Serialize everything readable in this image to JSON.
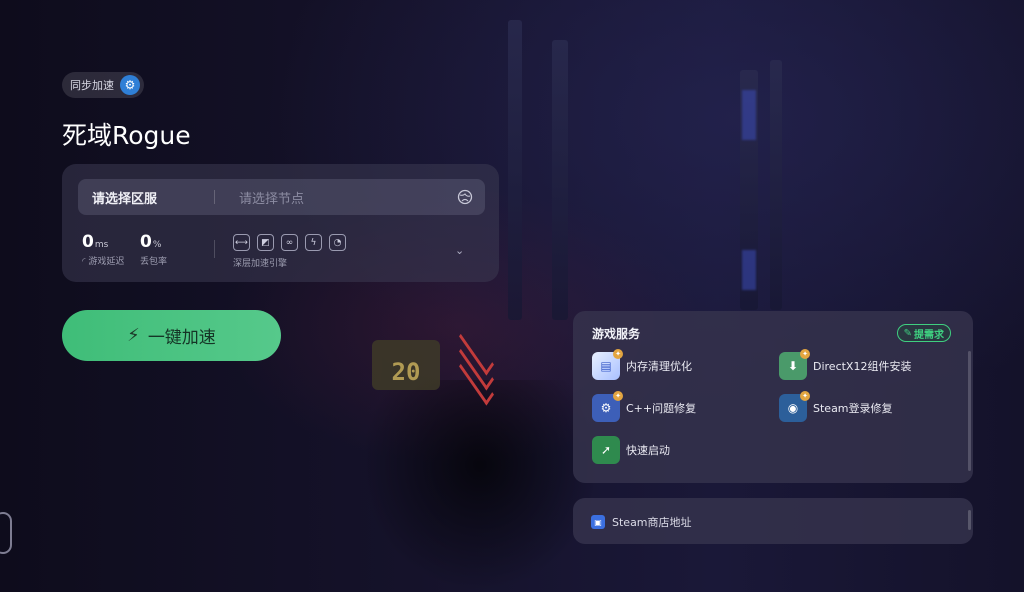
{
  "header": {
    "sync_badge_label": "同步加速",
    "game_title": "死域Rogue"
  },
  "accelerator": {
    "region_label": "请选择区服",
    "node_placeholder": "请选择节点",
    "latency_value": "0",
    "latency_unit": "ms",
    "latency_label": "游戏延迟",
    "loss_value": "0",
    "loss_unit": "%",
    "loss_label": "丢包率",
    "engine_label": "深层加速引擎",
    "engine_icons": [
      "link-icon",
      "screen-icon",
      "chain-icon",
      "bolt-shield-icon",
      "speed-icon"
    ]
  },
  "launch_button_label": "一键加速",
  "services": {
    "title": "游戏服务",
    "request_label": "提需求",
    "items": [
      {
        "label": "内存清理优化",
        "icon": "memory-clean-icon",
        "color": "#c8d8ff"
      },
      {
        "label": "DirectX12组件安装",
        "icon": "directx-icon",
        "color": "#4a9a6a"
      },
      {
        "label": "C++问题修复",
        "icon": "cpp-fix-icon",
        "color": "#3d5fb8"
      },
      {
        "label": "Steam登录修复",
        "icon": "steam-fix-icon",
        "color": "#2c5f9a"
      },
      {
        "label": "快速启动",
        "icon": "quick-launch-icon",
        "color": "#2f8a4e"
      }
    ]
  },
  "store": {
    "label": "Steam商店地址"
  },
  "background": {
    "emblem_text": "20"
  }
}
